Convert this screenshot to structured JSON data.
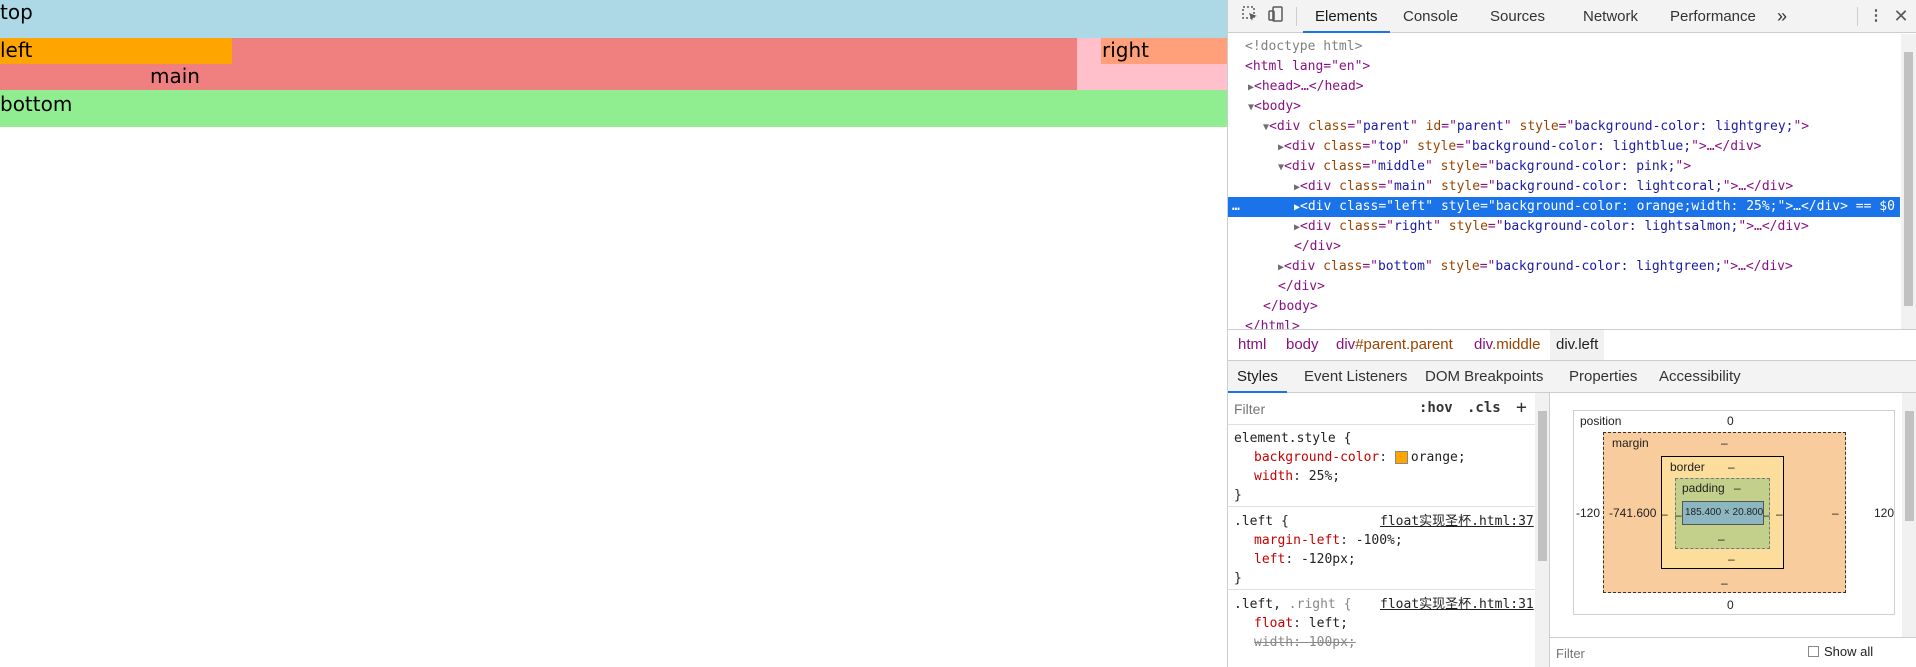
{
  "page": {
    "top_text": "top",
    "left_text": "left",
    "main_text": "main",
    "right_text": "right",
    "bottom_text": "bottom",
    "colors": {
      "top": "#add8e6",
      "middle": "#ffc0cb",
      "main": "#f08080",
      "left": "#ffa500",
      "right": "#ffa07a",
      "bottom": "#90ee90"
    }
  },
  "devtools": {
    "tabs": [
      "Elements",
      "Console",
      "Sources",
      "Network",
      "Performance"
    ],
    "active_tab": "Elements",
    "more_tabs": "»",
    "icons": {
      "inspect": "inspect-element-icon",
      "device": "device-toolbar-icon",
      "menu": "kebab-menu-icon",
      "close": "close-icon"
    },
    "dom": {
      "doctype": "<!doctype html>",
      "html_open": "<html lang=\"en\">",
      "head": "<head>…</head>",
      "body_open": "<body>",
      "parent_div": {
        "tag": "div",
        "class": "parent",
        "id": "parent",
        "style": "background-color: lightgrey;"
      },
      "top_div": {
        "tag": "div",
        "class": "top",
        "style": "background-color: lightblue;"
      },
      "middle_div": {
        "tag": "div",
        "class": "middle",
        "style": "background-color: pink;"
      },
      "main_div": {
        "tag": "div",
        "class": "main",
        "style": "background-color: lightcoral;"
      },
      "left_div": {
        "tag": "div",
        "class": "left",
        "style": "background-color: orange;width: 25%;"
      },
      "right_div": {
        "tag": "div",
        "class": "right",
        "style": "background-color: lightsalmon;"
      },
      "bottom_div": {
        "tag": "div",
        "class": "bottom",
        "style": "background-color: lightgreen;"
      },
      "close_div": "</div>",
      "close_body": "</body>",
      "close_html": "</html>",
      "collapsed": "…",
      "selected_marker": "…",
      "selected_suffix": "== $0"
    },
    "breadcrumbs": [
      {
        "label": "html"
      },
      {
        "label": "body"
      },
      {
        "label": "div",
        "cls": "#parent.parent"
      },
      {
        "label": "div",
        "cls": ".middle"
      },
      {
        "label": "div.left",
        "current": true
      }
    ],
    "sub_tabs": [
      "Styles",
      "Event Listeners",
      "DOM Breakpoints",
      "Properties",
      "Accessibility"
    ],
    "active_sub_tab": "Styles",
    "styles": {
      "filter_placeholder": "Filter",
      "hov": ":hov",
      "cls": ".cls",
      "add": "+",
      "rules": [
        {
          "selector": "element.style {",
          "decls": [
            {
              "name": "background-color",
              "value": "orange;",
              "swatch": "#ffa500"
            },
            {
              "name": "width",
              "value": "25%;"
            }
          ],
          "close": "}"
        },
        {
          "selector": ".left {",
          "source": "float实现圣杯.html:37",
          "decls": [
            {
              "name": "margin-left",
              "value": "-100%;"
            },
            {
              "name": "left",
              "value": "-120px;"
            }
          ],
          "close": "}"
        },
        {
          "selector_main": ".left,",
          "selector_dim": " .right {",
          "source": "float实现圣杯.html:31",
          "decls": [
            {
              "name": "float",
              "value": "left;"
            },
            {
              "name": "width",
              "value": "100px;",
              "overridden": true
            }
          ]
        }
      ]
    },
    "box_model": {
      "position_label": "position",
      "position_top": "0",
      "position_bottom": "0",
      "position_left": "-120",
      "position_right": "120",
      "margin_label": "margin",
      "margin_top": "–",
      "margin_bottom": "–",
      "margin_left": "-741.600",
      "margin_right": "–",
      "border_label": "border",
      "border_top": "–",
      "border_bottom": "–",
      "border_left": "–",
      "border_right": "–",
      "padding_label": "padding",
      "padding_top": "–",
      "padding_bottom": "–",
      "padding_left": "–",
      "padding_right": "–",
      "content_size": "185.400 × 20.800",
      "filter_placeholder": "Filter",
      "show_all": "Show all"
    }
  }
}
